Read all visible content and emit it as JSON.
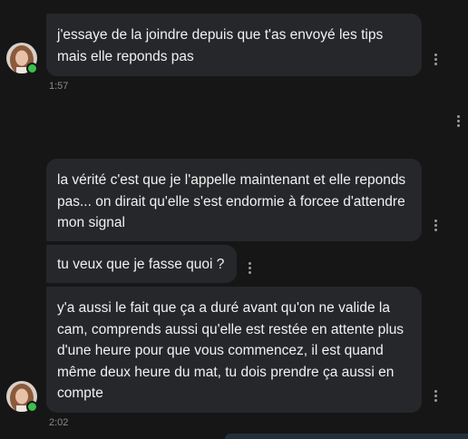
{
  "colors": {
    "background": "#161617",
    "bubble": "#26272a",
    "text": "#f1f1f1",
    "timestamp": "#8a8a8f",
    "online": "#3cbf4e"
  },
  "messages": [
    {
      "text": "j'essaye de la joindre depuis que t'as envoyé les tips mais elle reponds pas"
    },
    {
      "text": "la vérité c'est que je l'appelle maintenant et elle reponds pas... on dirait qu'elle s'est endormie à forcee d'attendre mon signal"
    },
    {
      "text": "tu veux que je fasse quoi ?"
    },
    {
      "text": "y'a aussi le fait que ça a duré avant qu'on ne valide la cam, comprends aussi qu'elle est restée en attente plus d'une heure pour que vous commencez, il est quand même deux heure du mat, tu dois prendre ça aussi en compte"
    }
  ],
  "timestamps": {
    "group1": "1:57",
    "group2": "2:02"
  },
  "icons": {
    "options": "kebab-menu-icon",
    "status": "online-status-icon"
  }
}
